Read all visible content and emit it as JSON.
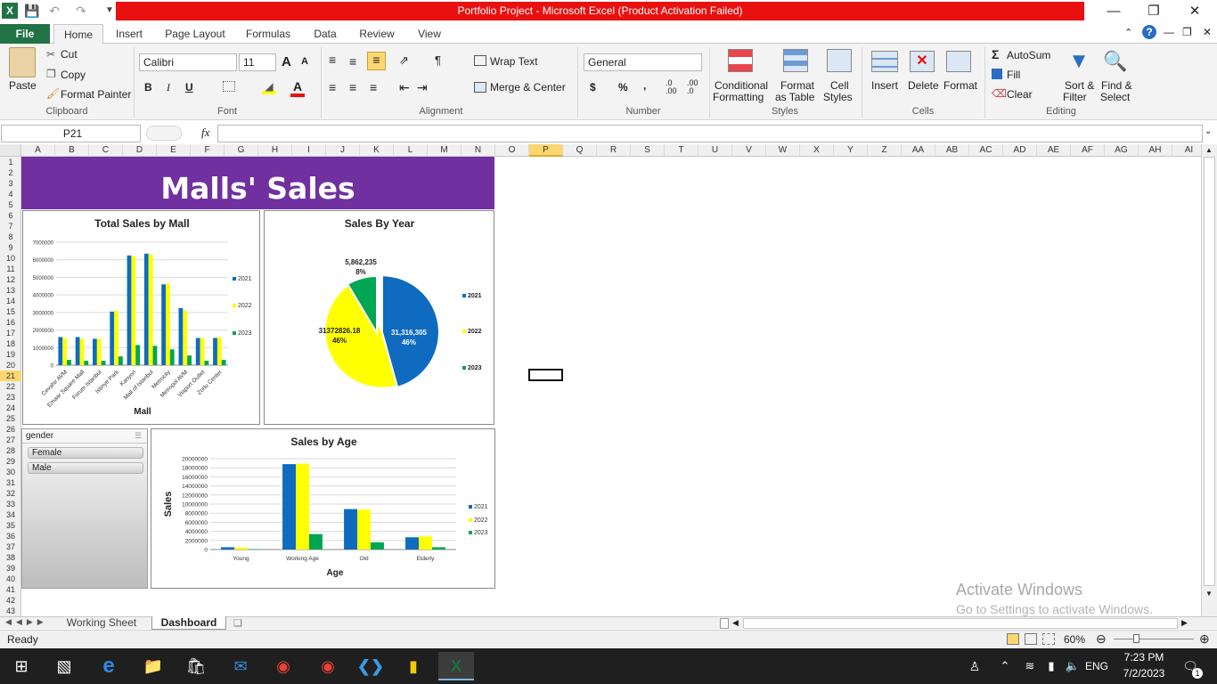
{
  "window": {
    "title": "Portfolio Project  -  Microsoft Excel (Product Activation Failed)",
    "controls": {
      "minimize": "—",
      "restore": "❐",
      "close": "✕"
    }
  },
  "ribbon_tabs": [
    "File",
    "Home",
    "Insert",
    "Page Layout",
    "Formulas",
    "Data",
    "Review",
    "View"
  ],
  "clipboard": {
    "paste": "Paste",
    "cut": "Cut",
    "copy": "Copy",
    "format_painter": "Format Painter",
    "label": "Clipboard"
  },
  "font": {
    "name": "Calibri",
    "size": "11",
    "bold": "B",
    "italic": "I",
    "underline": "U",
    "grow": "A",
    "shrink": "A",
    "label": "Font"
  },
  "alignment": {
    "wrap_text": "Wrap Text",
    "merge_center": "Merge & Center",
    "label": "Alignment"
  },
  "number": {
    "format": "General",
    "currency": "$",
    "percent": "%",
    "comma": ",",
    "inc_dec": ".0 .00",
    "dec_dec": ".00 .0",
    "label": "Number"
  },
  "styles": {
    "conditional": [
      "Conditional",
      "Formatting"
    ],
    "format_table": [
      "Format",
      "as Table"
    ],
    "cell_styles": [
      "Cell",
      "Styles"
    ],
    "label": "Styles"
  },
  "cells": {
    "insert": "Insert",
    "delete": "Delete",
    "format": "Format",
    "label": "Cells"
  },
  "editing": {
    "autosum": "AutoSum",
    "fill": "Fill",
    "clear": "Clear",
    "sort": [
      "Sort &",
      "Filter"
    ],
    "find": [
      "Find &",
      "Select"
    ],
    "label": "Editing"
  },
  "formula_bar": {
    "name_box": "P21",
    "fx": "fx",
    "value": ""
  },
  "columns": [
    "A",
    "B",
    "C",
    "D",
    "E",
    "F",
    "G",
    "H",
    "I",
    "J",
    "K",
    "L",
    "M",
    "N",
    "O",
    "P",
    "Q",
    "R",
    "S",
    "T",
    "U",
    "V",
    "W",
    "X",
    "Y",
    "Z",
    "AA",
    "AB",
    "AC",
    "AD",
    "AE",
    "AF",
    "AG",
    "AH",
    "AI"
  ],
  "rows": [
    "1",
    "2",
    "3",
    "4",
    "5",
    "6",
    "7",
    "8",
    "9",
    "10",
    "11",
    "12",
    "13",
    "14",
    "15",
    "16",
    "17",
    "18",
    "19",
    "20",
    "21",
    "22",
    "23",
    "24",
    "25",
    "26",
    "27",
    "28",
    "29",
    "30",
    "31",
    "32",
    "33",
    "34",
    "35",
    "36",
    "37",
    "38",
    "39",
    "40",
    "41",
    "42",
    "43"
  ],
  "dashboard": {
    "banner": "Malls' Sales"
  },
  "slicer": {
    "title": "gender",
    "items": [
      "Female",
      "Male"
    ]
  },
  "sheets": [
    "Working Sheet",
    "Dashboard"
  ],
  "status": {
    "ready": "Ready",
    "zoom": "60%"
  },
  "watermark": {
    "line1": "Activate Windows",
    "line2": "Go to Settings to activate Windows."
  },
  "taskbar": {
    "lang": "ENG",
    "time": "7:23 PM",
    "date": "7/2/2023",
    "notifications": "1"
  },
  "colors": {
    "s2021": "#0e6bbf",
    "s2022": "#ffff00",
    "s2023": "#00a651",
    "banner": "#7030a0",
    "file_tab": "#217346",
    "title_bar": "#e8110f"
  },
  "chart_data": [
    {
      "type": "bar",
      "title": "Total Sales by Mall",
      "xlabel": "Mall",
      "ylabel": "",
      "categories": [
        "Cevahir AVM",
        "Emaar Square Mall",
        "Forum Istanbul",
        "Istinye Park",
        "Kanyon",
        "Mall of Istanbul",
        "Metrocity",
        "Metropol AVM",
        "Viaport Outlet",
        "Zorlu Center"
      ],
      "series": [
        {
          "name": "2021",
          "values": [
            1600000,
            1600000,
            1500000,
            3050000,
            6250000,
            6350000,
            4600000,
            3250000,
            1550000,
            1550000
          ]
        },
        {
          "name": "2022",
          "values": [
            1550000,
            1500000,
            1500000,
            3100000,
            6200000,
            6300000,
            4650000,
            3100000,
            1550000,
            1600000
          ]
        },
        {
          "name": "2023",
          "values": [
            300000,
            250000,
            250000,
            500000,
            1150000,
            1100000,
            900000,
            550000,
            250000,
            300000
          ]
        }
      ],
      "yticks": [
        "0",
        "1000000",
        "2000000",
        "3000000",
        "4000000",
        "5000000",
        "6000000",
        "7000000"
      ],
      "ylim": [
        0,
        7000000
      ],
      "legend": "right"
    },
    {
      "type": "pie",
      "title": "Sales By Year",
      "slices": [
        {
          "name": "2021",
          "value": 31316305,
          "label": "31,316,305",
          "pct": "46%"
        },
        {
          "name": "2022",
          "value": 31372826.18,
          "label": "31372826.18",
          "pct": "46%"
        },
        {
          "name": "2023",
          "value": 5862235,
          "label": "5,862,235",
          "pct": "8%"
        }
      ],
      "legend": "right"
    },
    {
      "type": "bar",
      "title": "Sales by Age",
      "xlabel": "Age",
      "ylabel": "Sales",
      "categories": [
        "Young",
        "Working Age",
        "Old",
        "Elderly"
      ],
      "series": [
        {
          "name": "2021",
          "values": [
            500000,
            18800000,
            8900000,
            2700000
          ]
        },
        {
          "name": "2022",
          "values": [
            450000,
            18900000,
            8800000,
            2900000
          ]
        },
        {
          "name": "2023",
          "values": [
            100000,
            3400000,
            1600000,
            500000
          ]
        }
      ],
      "yticks": [
        "0",
        "2000000",
        "4000000",
        "6000000",
        "8000000",
        "10000000",
        "12000000",
        "14000000",
        "16000000",
        "18000000",
        "20000000"
      ],
      "ylim": [
        0,
        20000000
      ],
      "legend": "right"
    }
  ]
}
